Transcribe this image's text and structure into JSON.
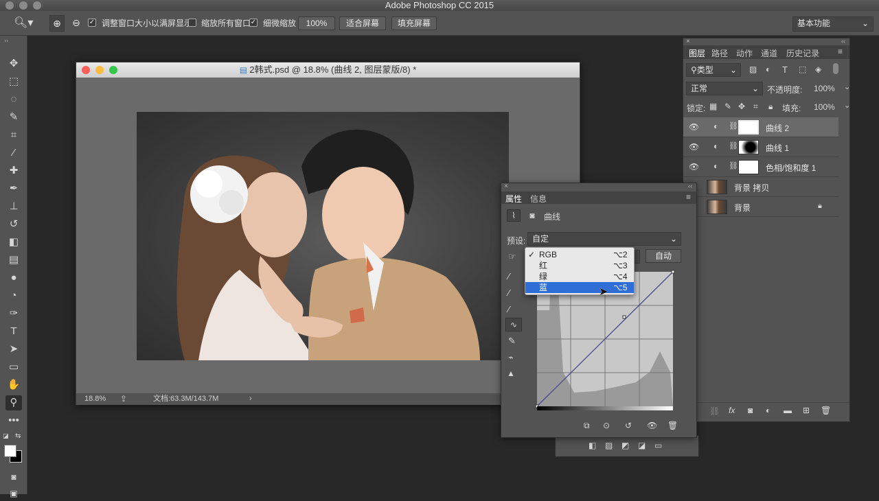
{
  "app_title": "Adobe Photoshop CC 2015",
  "options_bar": {
    "zoom_in_icon": "zoom-in-icon",
    "zoom_out_icon": "zoom-out-icon",
    "resize_windows_label": "调整窗口大小以满屏显示",
    "zoom_all_windows_label": "缩放所有窗口",
    "scrubby_zoom_label": "细微缩放",
    "zoom_value": "100%",
    "fit_screen_label": "适合屏幕",
    "fill_screen_label": "填充屏幕",
    "workspace_value": "基本功能",
    "resize_windows_checked": true,
    "zoom_all_checked": false,
    "scrubby_checked": true
  },
  "document": {
    "title": "2韩式.psd @ 18.8% (曲线 2, 图层蒙版/8) *",
    "zoom": "18.8%",
    "doc_size": "文档:63.3M/143.7M"
  },
  "layers_panel": {
    "tabs": [
      "图层",
      "路径",
      "动作",
      "通道",
      "历史记录"
    ],
    "filter_kind": "类型",
    "blend_mode": "正常",
    "opacity_label": "不透明度:",
    "opacity_value": "100%",
    "lock_label": "锁定:",
    "fill_label": "填充:",
    "fill_value": "100%",
    "layers": [
      {
        "name": "曲线 2",
        "selected": true
      },
      {
        "name": "曲线 1",
        "selected": false
      },
      {
        "name": "色相/饱和度 1",
        "selected": false
      },
      {
        "name": "背景 拷贝",
        "selected": false
      },
      {
        "name": "背景",
        "selected": false
      }
    ]
  },
  "properties_panel": {
    "tabs": [
      "属性",
      "信息"
    ],
    "panel_title": "曲线",
    "preset_label": "预设:",
    "preset_value": "自定",
    "auto_button": "自动"
  },
  "channel_menu": {
    "items": [
      {
        "label": "RGB",
        "shortcut": "⌥2",
        "checked": true
      },
      {
        "label": "红",
        "shortcut": "⌥3",
        "checked": false
      },
      {
        "label": "绿",
        "shortcut": "⌥4",
        "checked": false
      },
      {
        "label": "蓝",
        "shortcut": "⌥5",
        "checked": false
      }
    ],
    "highlighted": "蓝"
  },
  "colors": {
    "accent": "#2e6ed6",
    "panel_bg": "#535353",
    "app_bg": "#282828"
  }
}
